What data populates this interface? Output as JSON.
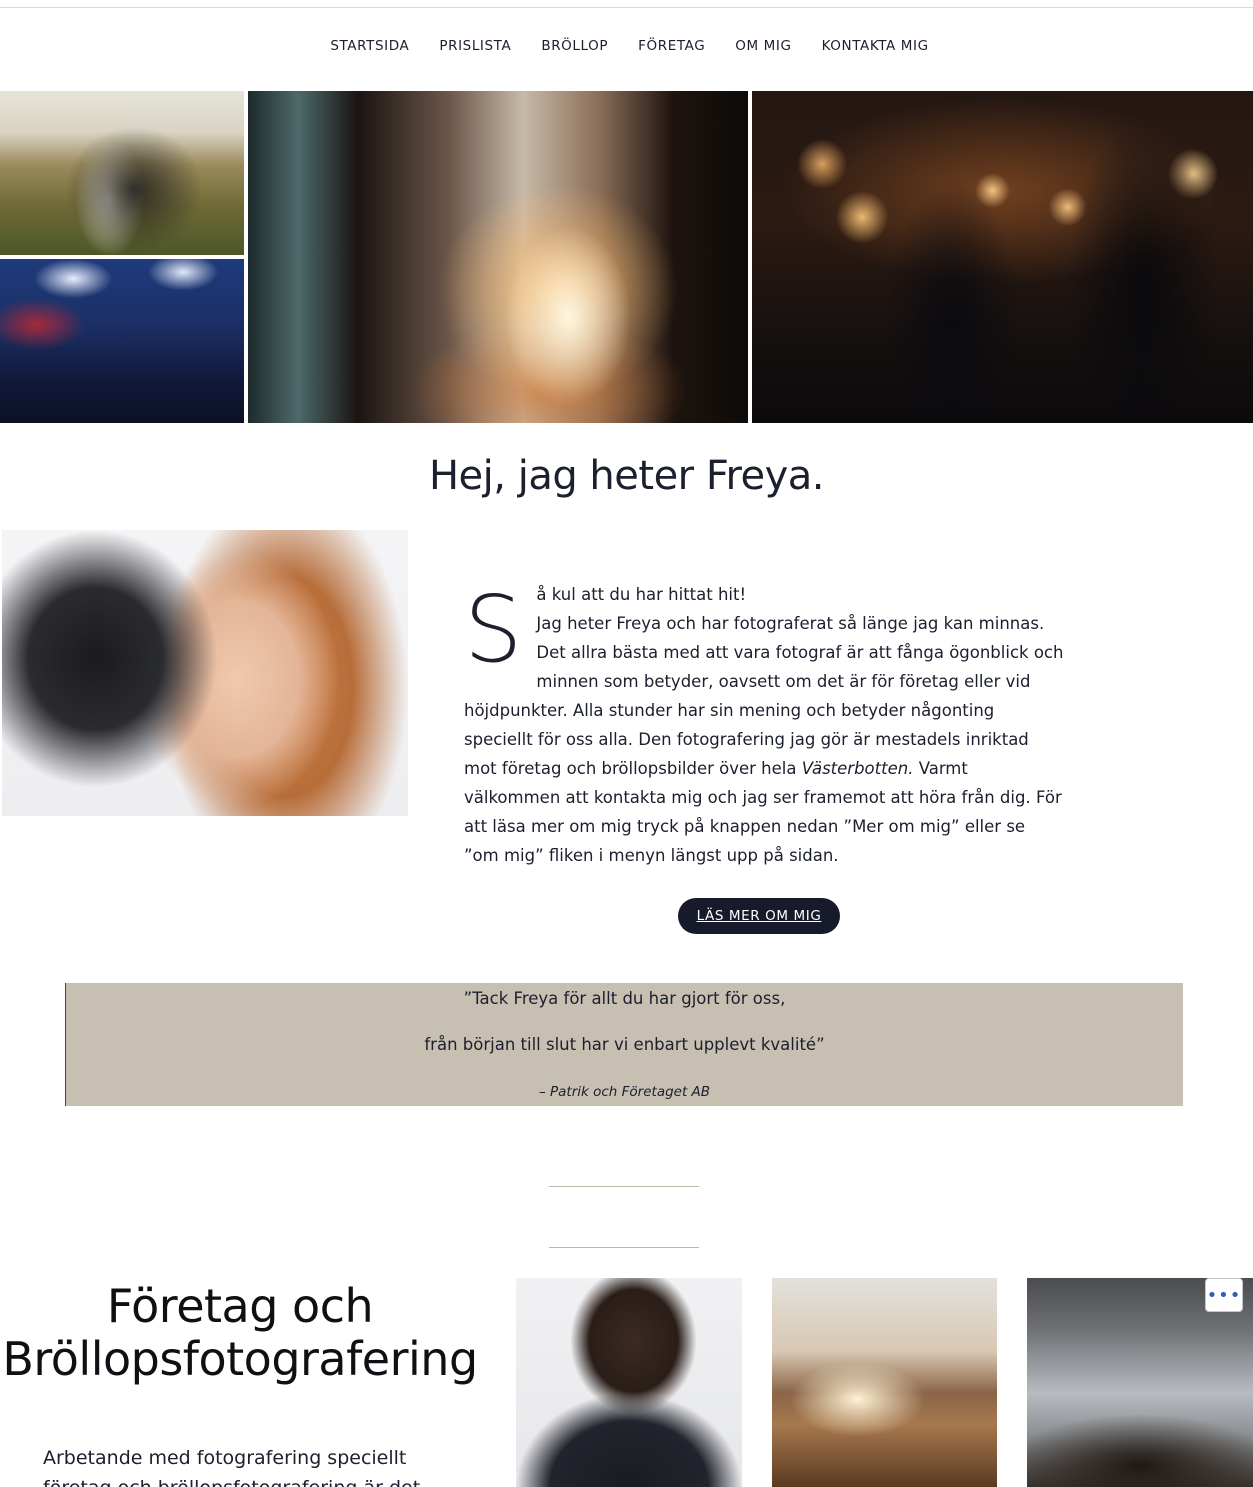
{
  "nav": {
    "items": [
      "STARTSIDA",
      "PRISLISTA",
      "BRÖLLOP",
      "FÖRETAG",
      "OM MIG",
      "KONTAKTA MIG"
    ]
  },
  "hero": {
    "photos": [
      "wedding-couple-photo",
      "conference-audience-photo",
      "venue-silhouettes-photo",
      "sparkler-send-off-photo"
    ]
  },
  "about": {
    "heading": "Hej, jag heter Freya.",
    "dropcap": "S",
    "first_line": "å kul att du har hittat hit!",
    "body_before": "Jag heter Freya och har fotograferat så länge jag kan minnas. Det allra bästa med att vara fotograf är att fånga ögonblick och minnen som betyder, oavsett om det är för företag eller vid höjdpunkter. Alla stunder har sin mening och betyder någonting speciellt för oss alla. Den fotografering jag gör är mestadels inriktad mot företag och bröllopsbilder över hela ",
    "body_em": "Västerbotten.",
    "body_after": " Varmt välkommen att kontakta mig och jag ser framemot att höra från dig. För att läsa mer om mig tryck på knappen nedan ”Mer om mig” eller se ”om mig” fliken i menyn längst upp på sidan.",
    "button_label": "LÄS MER OM MIG"
  },
  "quote": {
    "line1": "”Tack Freya för allt du har gjort för oss,",
    "line2": "från början till slut har vi enbart upplevt kvalité”",
    "citation": "– Patrik och Företaget AB"
  },
  "services": {
    "title_line1": "Företag och",
    "title_line2": "Bröllopsfotografering",
    "text": "Arbetande med fotografering speciellt företag och bröllopsfotografering är det"
  },
  "more_button": "•••"
}
